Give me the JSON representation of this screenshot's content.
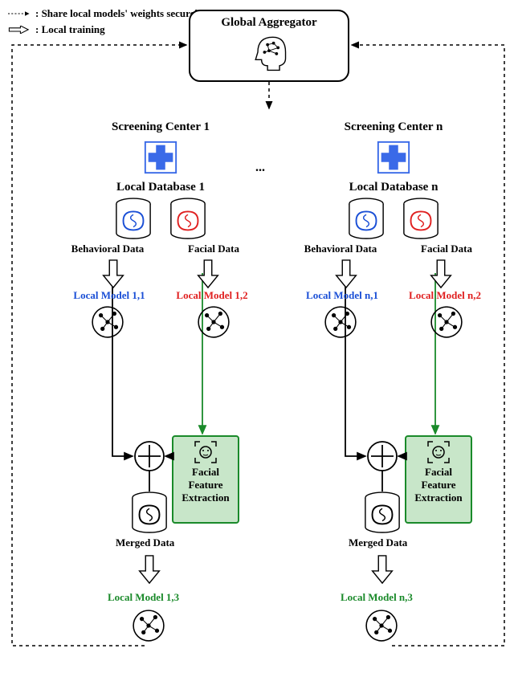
{
  "legend": {
    "dashed": ": Share local models' weights securely",
    "hollow": ": Local training"
  },
  "aggregator": {
    "title": "Global Aggregator"
  },
  "center1": {
    "title": "Screening Center 1",
    "db_title": "Local Database 1",
    "behavioral": "Behavioral Data",
    "facial": "Facial Data",
    "lm1": "Local Model 1,1",
    "lm2": "Local Model 1,2",
    "facial_box": "Facial Feature Extraction",
    "merged": "Merged Data",
    "lm3": "Local Model 1,3"
  },
  "centern": {
    "title": "Screening Center n",
    "db_title": "Local Database n",
    "behavioral": "Behavioral Data",
    "facial": "Facial Data",
    "lm1": "Local Model n,1",
    "lm2": "Local Model n,2",
    "facial_box": "Facial Feature Extraction",
    "merged": "Merged Data",
    "lm3": "Local Model n,3"
  },
  "ellipsis": "..."
}
